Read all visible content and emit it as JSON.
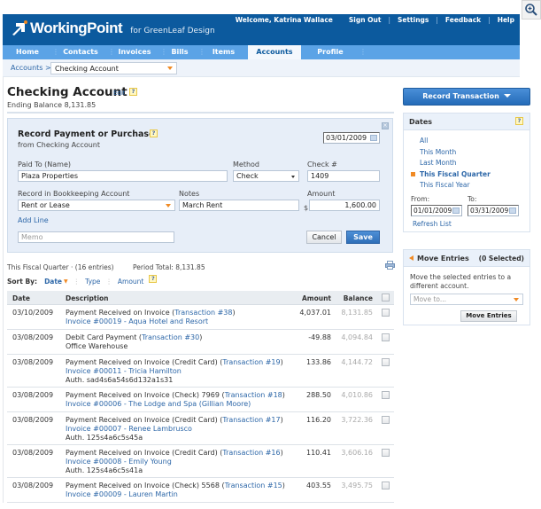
{
  "app": {
    "brand": "WorkingPoint",
    "brand_for": "for GreenLeaf Design",
    "welcome": "Welcome, Katrina Wallace",
    "top_links": [
      "Sign Out",
      "Settings",
      "Feedback",
      "Help"
    ]
  },
  "nav": {
    "tabs": [
      {
        "label": "Home",
        "active": false
      },
      {
        "label": "Contacts",
        "active": false
      },
      {
        "label": "Invoices",
        "active": false
      },
      {
        "label": "Bills",
        "active": false
      },
      {
        "label": "Items",
        "active": false
      },
      {
        "label": "Accounts",
        "active": true
      },
      {
        "label": "Profile",
        "active": false
      }
    ]
  },
  "breadcrumb": {
    "root": "Accounts >",
    "account_select": "Checking Account"
  },
  "page": {
    "title": "Checking Account",
    "edit": "Edit",
    "help": "?",
    "ending_balance": "Ending Balance 8,131.85"
  },
  "record_form": {
    "title": "Record Payment or Purchase",
    "subtitle": "from Checking Account",
    "date": "03/01/2009",
    "close": "×",
    "paid_to_label": "Paid To (Name)",
    "paid_to_value": "Plaza Properties",
    "method_label": "Method",
    "method_value": "Check",
    "check_label": "Check #",
    "check_value": "1409",
    "account_label": "Record in Bookkeeping Account",
    "account_value": "Rent or Lease",
    "notes_label": "Notes",
    "notes_value": "March Rent",
    "amount_label": "Amount",
    "currency": "$",
    "amount_value": "1,600.00",
    "add_line": "Add Line",
    "memo_placeholder": "Memo",
    "cancel": "Cancel",
    "save": "Save"
  },
  "list": {
    "summary": "This Fiscal Quarter · (16 entries)",
    "period_total": "Period Total: 8,131.85",
    "sort_label": "Sort By:",
    "sort_options": [
      "Date",
      "Type",
      "Amount"
    ],
    "sort_active": "Date",
    "columns": [
      "Date",
      "Description",
      "Amount",
      "Balance"
    ],
    "rows": [
      {
        "date": "03/10/2009",
        "desc": "Payment Received on Invoice (",
        "txn": "Transaction #38",
        "desc_end": ")",
        "line2": "Invoice #00019 - Aqua Hotel and Resort",
        "line2_link": true,
        "line3": "",
        "amount": "4,037.01",
        "balance": "8,131.85"
      },
      {
        "date": "03/08/2009",
        "desc": "Debit Card Payment (",
        "txn": "Transaction #30",
        "desc_end": ")",
        "line2": "Office Warehouse",
        "line2_link": false,
        "line3": "",
        "amount": "-49.88",
        "balance": "4,094.84"
      },
      {
        "date": "03/08/2009",
        "desc": "Payment Received on Invoice (Credit Card) (",
        "txn": "Transaction #19",
        "desc_end": ")",
        "line2": "Invoice #00011 - Tricia Hamilton",
        "line2_link": true,
        "line3": "Auth. sad4s6a54s6d132a1s31",
        "amount": "133.86",
        "balance": "4,144.72"
      },
      {
        "date": "03/08/2009",
        "desc": "Payment Received on Invoice (Check) 7969 (",
        "txn": "Transaction #18",
        "desc_end": ")",
        "line2": "Invoice #00006 - The Lodge and Spa (Gillian Moore)",
        "line2_link": true,
        "line3": "",
        "amount": "288.50",
        "balance": "4,010.86"
      },
      {
        "date": "03/08/2009",
        "desc": "Payment Received on Invoice (Credit Card) (",
        "txn": "Transaction #17",
        "desc_end": ")",
        "line2": "Invoice #00007 - Renee Lambrusco",
        "line2_link": true,
        "line3": "Auth. 125s4a6c5s45a",
        "amount": "116.20",
        "balance": "3,722.36"
      },
      {
        "date": "03/08/2009",
        "desc": "Payment Received on Invoice (Credit Card) (",
        "txn": "Transaction #16",
        "desc_end": ")",
        "line2": "Invoice #00008 - Emily Young",
        "line2_link": true,
        "line3": "Auth. 125s4a6c5s41a",
        "amount": "110.41",
        "balance": "3,606.16"
      },
      {
        "date": "03/08/2009",
        "desc": "Payment Received on Invoice (Check) 5568 (",
        "txn": "Transaction #15",
        "desc_end": ")",
        "line2": "Invoice #00009 - Lauren Martin",
        "line2_link": true,
        "line3": "",
        "amount": "403.55",
        "balance": "3,495.75"
      }
    ]
  },
  "sidebar": {
    "record_transaction": "Record Transaction",
    "dates": {
      "title": "Dates",
      "options": [
        "All",
        "This Month",
        "Last Month",
        "This Fiscal Quarter",
        "This Fiscal Year"
      ],
      "selected": "This Fiscal Quarter",
      "from_label": "From:",
      "to_label": "To:",
      "from_value": "01/01/2009",
      "to_value": "03/31/2009",
      "refresh": "Refresh List"
    },
    "move": {
      "title": "Move Entries",
      "selected_count": "(0 Selected)",
      "description": "Move the selected entries to a different account.",
      "placeholder": "Move to...",
      "button": "Move Entries"
    }
  },
  "colors": {
    "header_bg": "#0c5a9e",
    "nav_bg": "#5ba3e6",
    "link": "#2d67a8",
    "accent_orange": "#f08a24",
    "panel_bg": "#e7eef8",
    "save_button": "#2f6fb8"
  }
}
